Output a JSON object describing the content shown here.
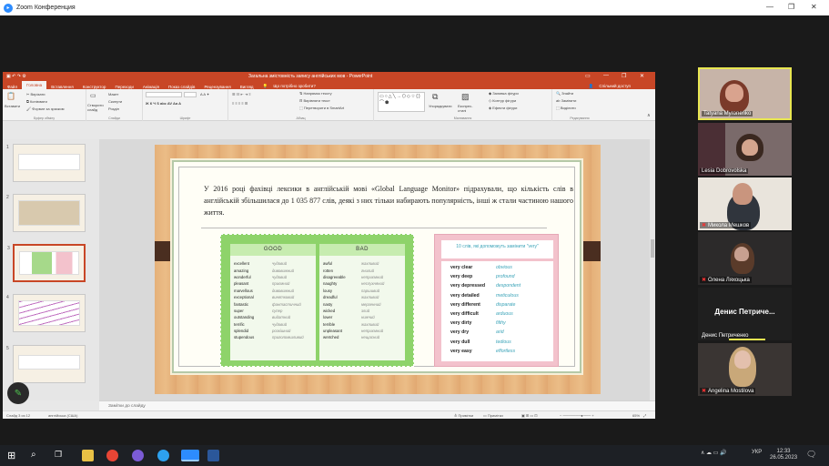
{
  "zoom": {
    "title": "Zoom Конференция"
  },
  "ppt": {
    "window_title": "Загальна змістовність запису англійських мов - PowerPoint",
    "menu": [
      "Файл",
      "Головна",
      "Вставлення",
      "Конструктор",
      "Переходи",
      "Анімація",
      "Показ слайдів",
      "Рецензування",
      "Вигляд"
    ],
    "active_tab": "Головна",
    "search_hint": "Що потрібно зробити?",
    "share": "Спільний доступ",
    "ribbon": {
      "paste": "Вставити",
      "cut": "Вирізати",
      "copy": "Копіювати",
      "format_painter": "Формат за зразком",
      "clipboard": "Буфер обміну",
      "new_slide": "Створити слайд",
      "layout": "Макет",
      "reset": "Скинути",
      "section": "Розділ",
      "slides": "Слайди",
      "font": "Шрифт",
      "paragraph": "Абзац",
      "text_direction": "Напрямок тексту",
      "align_text": "Вирівняти текст",
      "convert_smartart": "Перетворити в SmartArt",
      "arrange": "Упорядкувати",
      "quick_styles": "Експрес-стилі",
      "shape_fill": "Заливка фігури",
      "shape_outline": "Контур фігури",
      "shape_effects": "Ефекти фігури",
      "drawing": "Малювання",
      "find": "Знайти",
      "replace": "Замінити",
      "select": "Виділити",
      "editing": "Редагування"
    },
    "slide": {
      "paragraph": "У 2016 році фахівці лексики в англійській мові «Global Language Monitor» підрахували, що кількість слів в англійській збільшилася до 1 035 877 слів, деякі з них тільки набирають популярність, інші ж стали частиною нашого життя.",
      "good": {
        "header": "GOOD",
        "rows": [
          [
            "excellent",
            "чудовий"
          ],
          [
            "amazing",
            "дивовижний"
          ],
          [
            "wonderful",
            "чудовий"
          ],
          [
            "pleasant",
            "приємний"
          ],
          [
            "marvellous",
            "дивовижний"
          ],
          [
            "exceptional",
            "винятковий"
          ],
          [
            "fantastic",
            "фантастичний"
          ],
          [
            "super",
            "супер"
          ],
          [
            "outstanding",
            "видатний"
          ],
          [
            "terrific",
            "чудовий"
          ],
          [
            "splendid",
            "розкішний"
          ],
          [
            "stupendous",
            "приголомшливий"
          ]
        ]
      },
      "bad": {
        "header": "BAD",
        "rows": [
          [
            "awful",
            "жахливий"
          ],
          [
            "rotten",
            "гнилий"
          ],
          [
            "disagreeable",
            "неприємний"
          ],
          [
            "naughty",
            "неслухняний"
          ],
          [
            "lousy",
            "паршивий"
          ],
          [
            "dreadful",
            "жахливий"
          ],
          [
            "nasty",
            "мерзенний"
          ],
          [
            "wicked",
            "злий"
          ],
          [
            "lower",
            "нижчий"
          ],
          [
            "terrible",
            "жахливий"
          ],
          [
            "unpleasant",
            "неприємний"
          ],
          [
            "wretched",
            "нещасний"
          ]
        ]
      },
      "very": {
        "header": "10 слів, які допоможуть замінити \"very\"",
        "rows": [
          [
            "very clear",
            "obvious"
          ],
          [
            "very deep",
            "profound"
          ],
          [
            "very depressed",
            "despondent"
          ],
          [
            "very detailed",
            "meticulous"
          ],
          [
            "very different",
            "disparate"
          ],
          [
            "very difficult",
            "arduous"
          ],
          [
            "very dirty",
            "filthy"
          ],
          [
            "very dry",
            "arid"
          ],
          [
            "very dull",
            "tedious"
          ],
          [
            "very easy",
            "effortless"
          ]
        ]
      }
    },
    "notes": "Замітки до слайду",
    "status": {
      "slide_count": "Слайд 3 из 12",
      "language": "англійська (США)",
      "notes_btn": "Примітки",
      "comments_btn": "Примітки",
      "zoom": "65%"
    },
    "slide_numbers": [
      "1",
      "2",
      "3",
      "4",
      "5"
    ]
  },
  "participants": [
    {
      "name": "Tatyana Myronenko",
      "active": true,
      "muted": false
    },
    {
      "name": "Lesia Dobrovolska",
      "active": false,
      "muted": false
    },
    {
      "name": "Микола Мешков",
      "active": false,
      "muted": true
    },
    {
      "name": "Олена Ляхоцька",
      "active": false,
      "muted": true
    },
    {
      "name": "Денис Петриченко",
      "display": "Денис Петриче...",
      "active": false,
      "muted": false
    },
    {
      "name": "Angelina Mostilova",
      "active": false,
      "muted": true
    }
  ],
  "taskbar": {
    "language": "УКР",
    "time": "12:33",
    "date": "26.05.2023"
  }
}
